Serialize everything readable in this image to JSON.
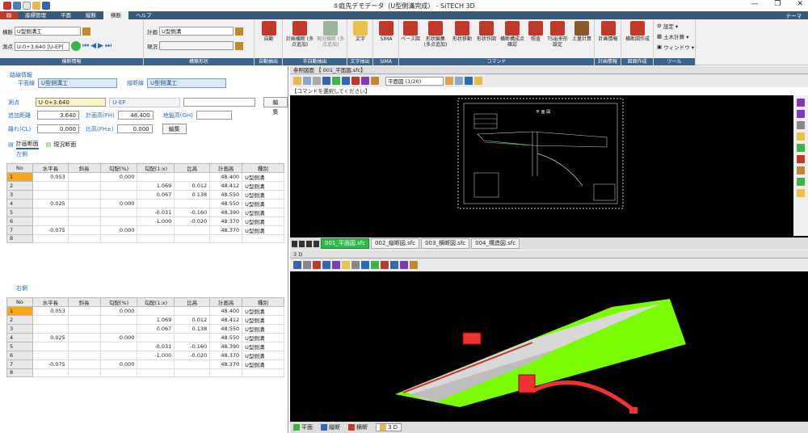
{
  "window": {
    "title": "⑤庭先デモデータ（U型側溝完成） - SiTECH 3D",
    "close": "✕",
    "maximize": "❐",
    "minimize": "—"
  },
  "menu": {
    "tabs": [
      "座標管理",
      "平面",
      "縦断",
      "横断",
      "ヘルプ"
    ],
    "active": "横断",
    "theme": "テーマ"
  },
  "ribbon": {
    "group1": {
      "label": "横断情報",
      "row1_label": "横断",
      "row1_value": "U型側溝工",
      "row2_label": "測点",
      "row2_value": "U-0+3.640 [U-EP]"
    },
    "group2": {
      "label": "構築形状",
      "row1_label": "計画",
      "row1_value": "U型側溝",
      "row2_label": "現況",
      "row2_value": ""
    },
    "buttons": [
      {
        "label": "自動",
        "group": "自動抽出"
      },
      {
        "label": "計画横断 (多点追加)",
        "group": "半自動抽出"
      },
      {
        "label": "現況横断 (多点追加)",
        "group": "半自動抽出"
      },
      {
        "label": "文字",
        "group": "文字抽出"
      },
      {
        "label": "SIMA",
        "group": "SIMA"
      },
      {
        "label": "ベース図",
        "group": "コマンド"
      },
      {
        "label": "形状編集 (多点追加)",
        "group": "コマンド"
      },
      {
        "label": "形状移動",
        "group": "コマンド"
      },
      {
        "label": "形状作図",
        "group": "コマンド"
      },
      {
        "label": "横断構成点 確認",
        "group": "コマンド"
      },
      {
        "label": "照査",
        "group": "コマンド"
      },
      {
        "label": "TS出来形 設定",
        "group": "コマンド"
      },
      {
        "label": "土量計算",
        "group": "コマンド"
      },
      {
        "label": "計画情報",
        "group": "計画情報"
      },
      {
        "label": "横断図作成",
        "group": "図面作成"
      }
    ],
    "group_labels": [
      "横断情報",
      "構築形状",
      "自動抽出",
      "半自動抽出",
      "文字抽出",
      "SIMA",
      "コマンド",
      "計画情報",
      "図面作成",
      "ツール"
    ],
    "tools": {
      "label": "ツール",
      "items": [
        "設定 ▾",
        "土木計算 ▾",
        "ウィンドウ ▾"
      ]
    }
  },
  "left": {
    "route_info": "路線情報",
    "plane_label": "平面線",
    "plane_value": "U型側溝工",
    "vert_label": "縦断線",
    "vert_value": "U型側溝工",
    "station_label": "測点",
    "station_value": "U-0+3.640",
    "station_sub": "U-EP",
    "edit1": "編集",
    "add_dist_label": "追加距離",
    "add_dist": "3.640",
    "plan_height_label": "計画高(FH)",
    "plan_height": "48.400",
    "ground_label": "地盤高(GH)",
    "ground_value": "",
    "offset_label": "離れ(CL)",
    "offset": "0.000",
    "ratio_label": "比高(FH±)",
    "ratio": "0.000",
    "edit2": "編集",
    "tab_plan": "計画断面",
    "tab_current": "現況断面",
    "left_side": "左側",
    "right_side": "右側",
    "headers": [
      "No",
      "水平長",
      "斜長",
      "勾配(%)",
      "勾配(1:x)",
      "比高",
      "計画高",
      "種別"
    ],
    "rows": [
      [
        "1",
        "0.053",
        "",
        "0.000",
        "",
        "",
        "48.400",
        "U型側溝"
      ],
      [
        "2",
        "",
        "",
        "",
        "1.069",
        "0.012",
        "48.412",
        "U型側溝"
      ],
      [
        "3",
        "",
        "",
        "",
        "0.067",
        "0.138",
        "48.550",
        "U型側溝"
      ],
      [
        "4",
        "0.025",
        "",
        "0.000",
        "",
        "",
        "48.550",
        "U型側溝"
      ],
      [
        "5",
        "",
        "",
        "",
        "-0.031",
        "-0.160",
        "48.390",
        "U型側溝"
      ],
      [
        "6",
        "",
        "",
        "",
        "-1.000",
        "-0.020",
        "48.370",
        "U型側溝"
      ],
      [
        "7",
        "-0.075",
        "",
        "0.000",
        "",
        "",
        "48.370",
        "U型側溝"
      ],
      [
        "8",
        "",
        "",
        "",
        "",
        "",
        "",
        ""
      ]
    ]
  },
  "ref": {
    "header": "参照図面 【 001_平面図.sfc】",
    "scale": "平面図 (1/20)",
    "command": "【コマンドを選択してください】",
    "drawing_title": "平 面 図",
    "sheets": [
      "001_平面図.sfc",
      "002_縦断図.sfc",
      "003_横断図.sfc",
      "004_構造図.sfc"
    ],
    "active_sheet": "001_平面図.sfc"
  },
  "view3d": {
    "header": "3 D",
    "tabs": [
      "平面",
      "縦断",
      "横断",
      "3 D"
    ],
    "active_tab": "3 D"
  },
  "colors": {
    "accent": "#3e6387",
    "green": "#7cfc00",
    "highlight": "#f6a623"
  }
}
